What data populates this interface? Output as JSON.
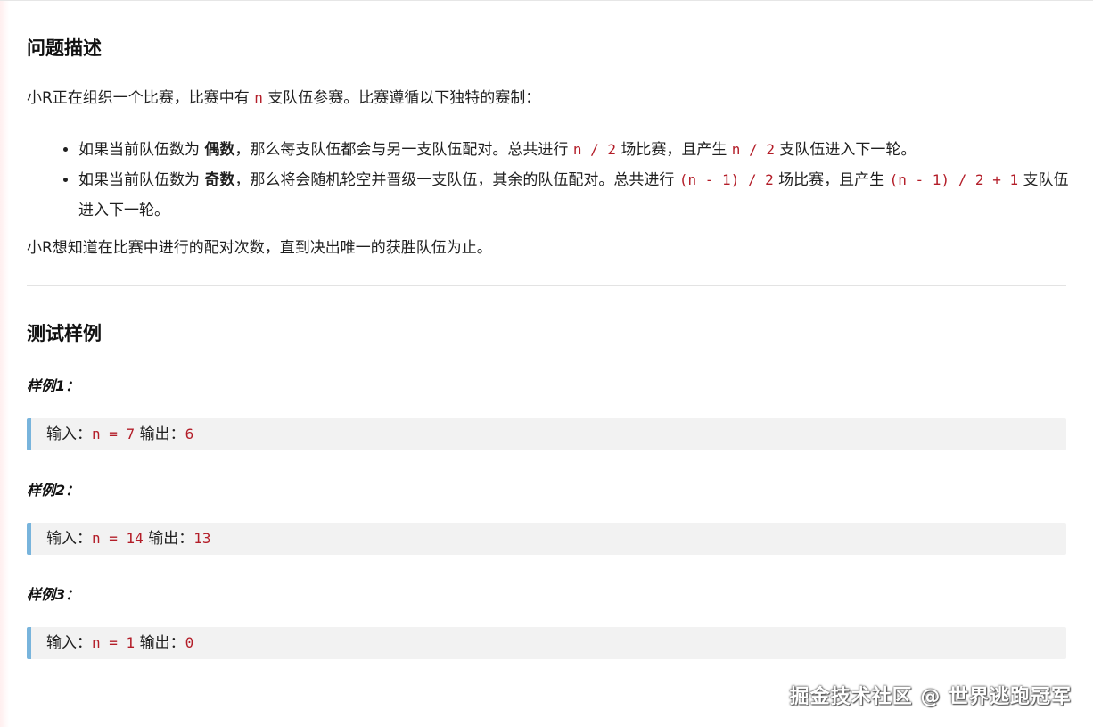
{
  "problem": {
    "heading": "问题描述",
    "intro": {
      "before": "小R正在组织一个比赛，比赛中有 ",
      "code": "n",
      "after": " 支队伍参赛。比赛遵循以下独特的赛制："
    },
    "rules": [
      {
        "t1": "如果当前队伍数为 ",
        "bold": "偶数",
        "t2": "，那么每支队伍都会与另一支队伍配对。总共进行 ",
        "c1": "n / 2",
        "t3": " 场比赛，且产生 ",
        "c2": "n / 2",
        "t4": " 支队伍进入下一轮。"
      },
      {
        "t1": "如果当前队伍数为 ",
        "bold": "奇数",
        "t2": "，那么将会随机轮空并晋级一支队伍，其余的队伍配对。总共进行 ",
        "c1": "(n - 1) / 2",
        "t3": " 场比赛，且产生 ",
        "c2": "(n - 1) / 2 + 1",
        "t4": " 支队伍进入下一轮。"
      }
    ],
    "outro": "小R想知道在比赛中进行的配对次数，直到决出唯一的获胜队伍为止。"
  },
  "tests": {
    "heading": "测试样例",
    "examples": [
      {
        "label": "样例1：",
        "input_label": "输入：",
        "input_code": "n = 7",
        "output_label": "输出：",
        "output_code": "6"
      },
      {
        "label": "样例2：",
        "input_label": "输入：",
        "input_code": "n = 14",
        "output_label": "输出：",
        "output_code": "13"
      },
      {
        "label": "样例3：",
        "input_label": "输入：",
        "input_code": "n = 1",
        "output_label": "输出：",
        "output_code": "0"
      }
    ]
  },
  "watermark": "掘金技术社区 @ 世界逃跑冠军",
  "colors": {
    "code": "#b31d28",
    "quote_border": "#78b4dc",
    "quote_bg": "#f2f2f2"
  }
}
